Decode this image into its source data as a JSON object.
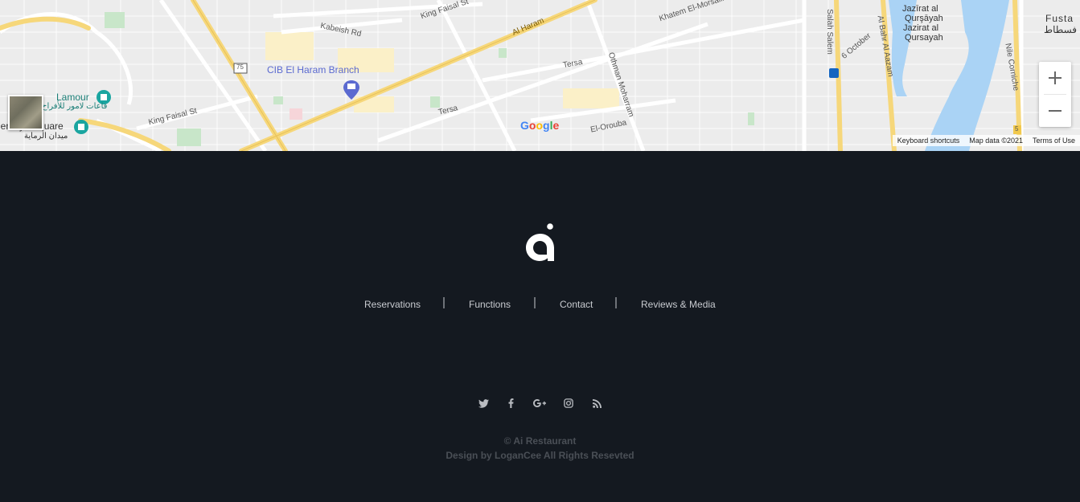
{
  "map": {
    "road_labels": {
      "king_faisal_top": "King Faisal St",
      "kabeish": "Kabeish Rd",
      "al_haram": "Al Haram",
      "khatem": "Khatem El-Morsalin",
      "tersa_1": "Tersa",
      "tersa_2": "Tersa",
      "othman": "Othman Moharram",
      "king_faisal_bottom": "King Faisal St",
      "el_orouba": "El-Orouba",
      "salah_salem": "Salah Salem",
      "six_october": "6 October",
      "al_bahr": "Al Bahr Al Aazam",
      "nile_corniche": "Nile Corniche",
      "route_75": "75",
      "route_5": "5"
    },
    "places": {
      "cib": "CIB El Haram Branch",
      "lamour": "Lamour",
      "lamour_ar": "قاعات لامور للأفراح",
      "remaya": "Remaya Square",
      "remaya_ar": "ميدان الرماية",
      "jazirat_1": "Jazīrat al",
      "jazirat_2": "Qurşāyah",
      "jazirat_3": "Jazirat al",
      "jazirat_4": "Qursayah",
      "fustat": "Fusta",
      "fustat_ar": "فسطاط"
    },
    "google": "Google",
    "attribution": {
      "shortcuts": "Keyboard shortcuts",
      "data": "Map data ©2021",
      "terms": "Terms of Use"
    },
    "zoom_in_icon": "plus-icon",
    "zoom_out_icon": "minus-icon"
  },
  "footer": {
    "brand": "ai",
    "nav": [
      "Reservations",
      "Functions",
      "Contact",
      "Reviews & Media"
    ],
    "social": [
      "twitter-icon",
      "facebook-icon",
      "google-plus-icon",
      "instagram-icon",
      "rss-icon"
    ],
    "copyright": "© Ai Restaurant",
    "credits": "Design by LoganCee All Rights Resevted"
  },
  "colors": {
    "footer_bg": "#141920",
    "map_bg": "#ececec",
    "major_road": "#f6d77a",
    "water": "#aad3f5",
    "park": "#c8e6c9",
    "nav_text": "#c8cbd0",
    "muted_text": "#4a4f56"
  }
}
